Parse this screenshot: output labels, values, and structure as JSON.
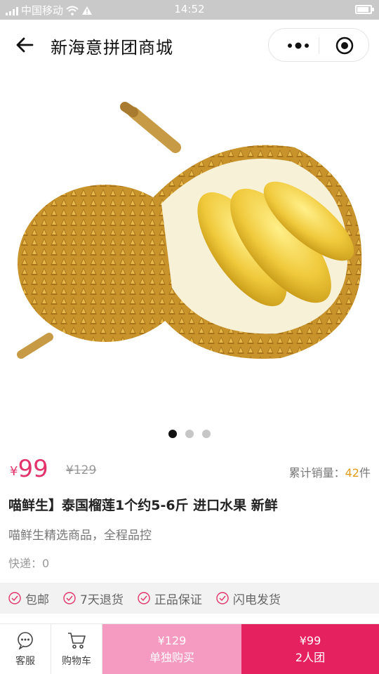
{
  "status_bar": {
    "carrier": "中国移动",
    "time": "14:52",
    "battery_level": 0.9
  },
  "nav": {
    "title": "新海意拼团商城"
  },
  "gallery": {
    "image_icon": "durian-image",
    "dots": 3,
    "active_index": 0
  },
  "price": {
    "currency": "¥",
    "current": "99",
    "original": "¥129",
    "sold_label": "累计销量：",
    "sold_count": "42",
    "sold_unit": "件"
  },
  "product": {
    "title": "喵鲜生】泰国榴莲1个约5-6斤 进口水果 新鲜",
    "subtitle": "喵鲜生精选商品，全程品控",
    "shipping": "快递：0"
  },
  "assurances": [
    "包邮",
    "7天退货",
    "正品保证",
    "闪电发货"
  ],
  "bottom": {
    "service_label": "客服",
    "cart_label": "购物车",
    "solo_price": "¥129",
    "solo_label": "单独购买",
    "group_price": "¥99",
    "group_label": "2人团"
  },
  "colors": {
    "accent": "#e3336b",
    "group_button": "#e6215f",
    "solo_button": "#f59ac0",
    "sold_count": "#e39b1b"
  }
}
